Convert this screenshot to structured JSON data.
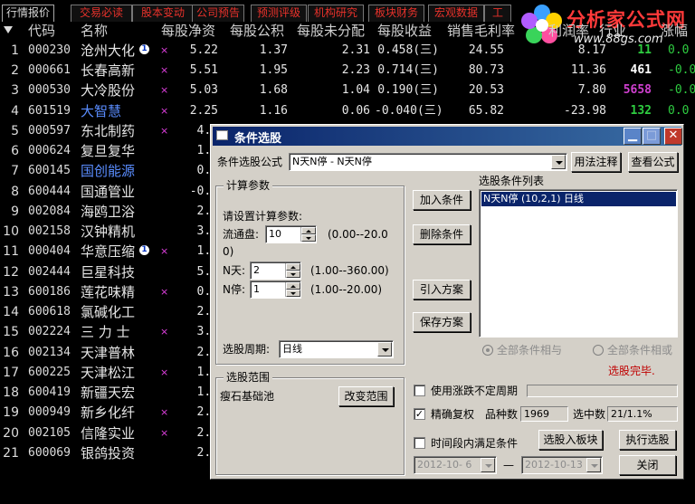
{
  "tabs": [
    {
      "label": "行情报价",
      "active": true
    },
    {
      "label": "交易必读",
      "active": false
    },
    {
      "label": "股本变动",
      "active": false
    },
    {
      "label": "公司预告",
      "active": false
    },
    {
      "label": "预测评级",
      "active": false
    },
    {
      "label": "机构研究",
      "active": false
    },
    {
      "label": "板块财务",
      "active": false
    },
    {
      "label": "宏观数据",
      "active": false
    },
    {
      "label": "工"
    }
  ],
  "logo": {
    "title": "分析家公式网",
    "url": "www.88gs.com"
  },
  "columns": [
    "代码",
    "名称",
    "每股净资",
    "每股公积",
    "每股未分配",
    "每股收益",
    "销售毛利率"
  ],
  "column_tail": [
    "利润率",
    "行业",
    "涨幅"
  ],
  "rows": [
    {
      "idx": "1",
      "code": "000230",
      "name": "沧州大化",
      "info": true,
      "mark": "×",
      "v1": "5.22",
      "v2": "1.37",
      "v3": "2.31",
      "v4": "0.458(三)",
      "v5": "24.55",
      "v6": "8.17",
      "v7": "11",
      "v7color": "#2ecc40",
      "v8": "0.0"
    },
    {
      "idx": "2",
      "code": "000661",
      "name": "长春高新",
      "mark": "×",
      "v1": "5.51",
      "v2": "1.95",
      "v3": "2.23",
      "v4": "0.714(三)",
      "v5": "80.73",
      "v6": "11.36",
      "v7": "461",
      "v7color": "#ffffff",
      "v8": "-0.0"
    },
    {
      "idx": "3",
      "code": "000530",
      "name": "大冷股份",
      "mark": "×",
      "v1": "5.03",
      "v2": "1.68",
      "v3": "1.04",
      "v4": "0.190(三)",
      "v5": "20.53",
      "v6": "7.80",
      "v7": "5658",
      "v7color": "#d040d0",
      "v8": "-0.0"
    },
    {
      "idx": "4",
      "code": "601519",
      "name": "大智慧",
      "blue": true,
      "mark": "×",
      "v1": "2.25",
      "v2": "1.16",
      "v3": "0.06",
      "v4": "-0.040(三)",
      "v5": "65.82",
      "v6": "-23.98",
      "v7": "132",
      "v7color": "#2ecc40",
      "v8": "0.0"
    },
    {
      "idx": "5",
      "code": "000597",
      "name": "东北制药",
      "mark": "×",
      "v1": "4.6"
    },
    {
      "idx": "6",
      "code": "000624",
      "name": "复旦复华",
      "v1": "1.6"
    },
    {
      "idx": "7",
      "code": "600145",
      "name": "国创能源",
      "blue": true,
      "v1": "0.5"
    },
    {
      "idx": "8",
      "code": "600444",
      "name": "国通管业",
      "v1": "-0.1"
    },
    {
      "idx": "9",
      "code": "002084",
      "name": "海鸥卫浴",
      "v1": "2.0"
    },
    {
      "idx": "10",
      "code": "002158",
      "name": "汉钟精机",
      "v1": "3.2"
    },
    {
      "idx": "11",
      "code": "000404",
      "name": "华意压缩",
      "info": true,
      "mark": "×",
      "v1": "1.9"
    },
    {
      "idx": "12",
      "code": "002444",
      "name": "巨星科技",
      "v1": "5.4"
    },
    {
      "idx": "13",
      "code": "600186",
      "name": "莲花味精",
      "mark": "×",
      "v1": "0.8"
    },
    {
      "idx": "14",
      "code": "600618",
      "name": "氯碱化工",
      "v1": "2.4"
    },
    {
      "idx": "15",
      "code": "002224",
      "name": "三 力 士",
      "mark": "×",
      "v1": "3.3"
    },
    {
      "idx": "16",
      "code": "002134",
      "name": "天津普林",
      "v1": "2.7"
    },
    {
      "idx": "17",
      "code": "600225",
      "name": "天津松江",
      "mark": "×",
      "v1": "1.7"
    },
    {
      "idx": "18",
      "code": "600419",
      "name": "新疆天宏",
      "v1": "1.5"
    },
    {
      "idx": "19",
      "code": "000949",
      "name": "新乡化纤",
      "mark": "×",
      "v1": "2.1"
    },
    {
      "idx": "20",
      "code": "002105",
      "name": "信隆实业",
      "mark": "×",
      "v1": "2.1"
    },
    {
      "idx": "21",
      "code": "600069",
      "name": "银鸽投资",
      "v1": "2.1"
    }
  ],
  "dialog": {
    "title": "条件选股",
    "formula_label": "条件选股公式",
    "formula_value": "N天N停  - N天N停",
    "usage_button": "用法注释",
    "view_button": "查看公式",
    "params_group": "计算参数",
    "params_prompt": "请设置计算参数:",
    "params": [
      {
        "label": "流通盘:",
        "value": "10",
        "range": "(0.00--20.0"
      },
      {
        "label": "N天:",
        "value": "2",
        "range": "(1.00--360.00)"
      },
      {
        "label": "N停:",
        "value": "1",
        "range": "(1.00--20.00)"
      }
    ],
    "range_wrap": "0)",
    "period_label": "选股周期:",
    "period_value": "日线",
    "add_button": "加入条件",
    "delete_button": "删除条件",
    "import_button": "引入方案",
    "save_button": "保存方案",
    "list_label": "选股条件列表",
    "conditions": [
      "N天N停  (10,2,1) 日线"
    ],
    "radio_and": "全部条件相与",
    "radio_or": "全部条件相或",
    "status_text": "选股完毕.",
    "status_color": "#c00000",
    "scope_group": "选股范围",
    "scope_value": "瘦石基础池",
    "change_scope_button": "改变范围",
    "opt_unfixed": "使用涨跌不定周期",
    "opt_adjust": "精确复权",
    "opt_adjust_checked": true,
    "count_label": "品种数",
    "count_value": "1969",
    "selected_label": "选中数",
    "selected_value": "21/1.1%",
    "opt_timerange": "时间段内满足条件",
    "to_board_button": "选股入板块",
    "run_button": "执行选股",
    "date_from": "2012-10- 6",
    "date_sep": "—",
    "date_to": "2012-10-13",
    "close_button": "关闭"
  }
}
